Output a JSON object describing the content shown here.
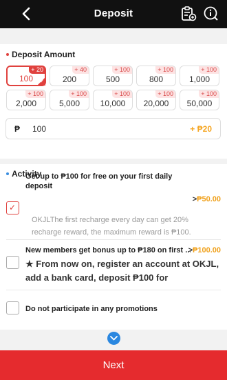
{
  "header": {
    "title": "Deposit",
    "back_icon": "back-arrow-icon",
    "records_icon": "records-icon",
    "info_icon": "info-icon"
  },
  "deposit": {
    "title": "Deposit Amount",
    "options": [
      {
        "value": "100",
        "bonus": "+ 20",
        "selected": true
      },
      {
        "value": "200",
        "bonus": "+ 40"
      },
      {
        "value": "500",
        "bonus": "+ 100"
      },
      {
        "value": "800",
        "bonus": "+ 100"
      },
      {
        "value": "1,000",
        "bonus": "+ 100"
      },
      {
        "value": "2,000",
        "bonus": "+ 100"
      },
      {
        "value": "5,000",
        "bonus": "+ 100"
      },
      {
        "value": "10,000",
        "bonus": "+ 100"
      },
      {
        "value": "20,000",
        "bonus": "+ 100"
      },
      {
        "value": "50,000",
        "bonus": "+ 100"
      }
    ],
    "currency_symbol": "₱",
    "input_value": "100",
    "gift": "+ ₱20"
  },
  "activity": {
    "title": "Activity",
    "items": [
      {
        "title": "Get up to ₱100 for free on your first daily deposit",
        "amount_prefix": ">",
        "amount": "₱50.00",
        "description": "OKJLThe first recharge every day can get 20% recharge reward, the maximum reward is ₱100.",
        "checked": true
      },
      {
        "title": "New members get bonus up to ₱180 on first ...",
        "amount_prefix": ">",
        "amount": "₱100.00",
        "description": "★ From now on, register an account at OKJL, add a bank card, deposit ₱100 for",
        "checked": false
      },
      {
        "title": "Do not participate in any promotions",
        "checked": false
      }
    ]
  },
  "next_label": "Next",
  "colors": {
    "accent": "#e52b2e",
    "gift": "#f5a623",
    "link": "#2a87e0"
  }
}
